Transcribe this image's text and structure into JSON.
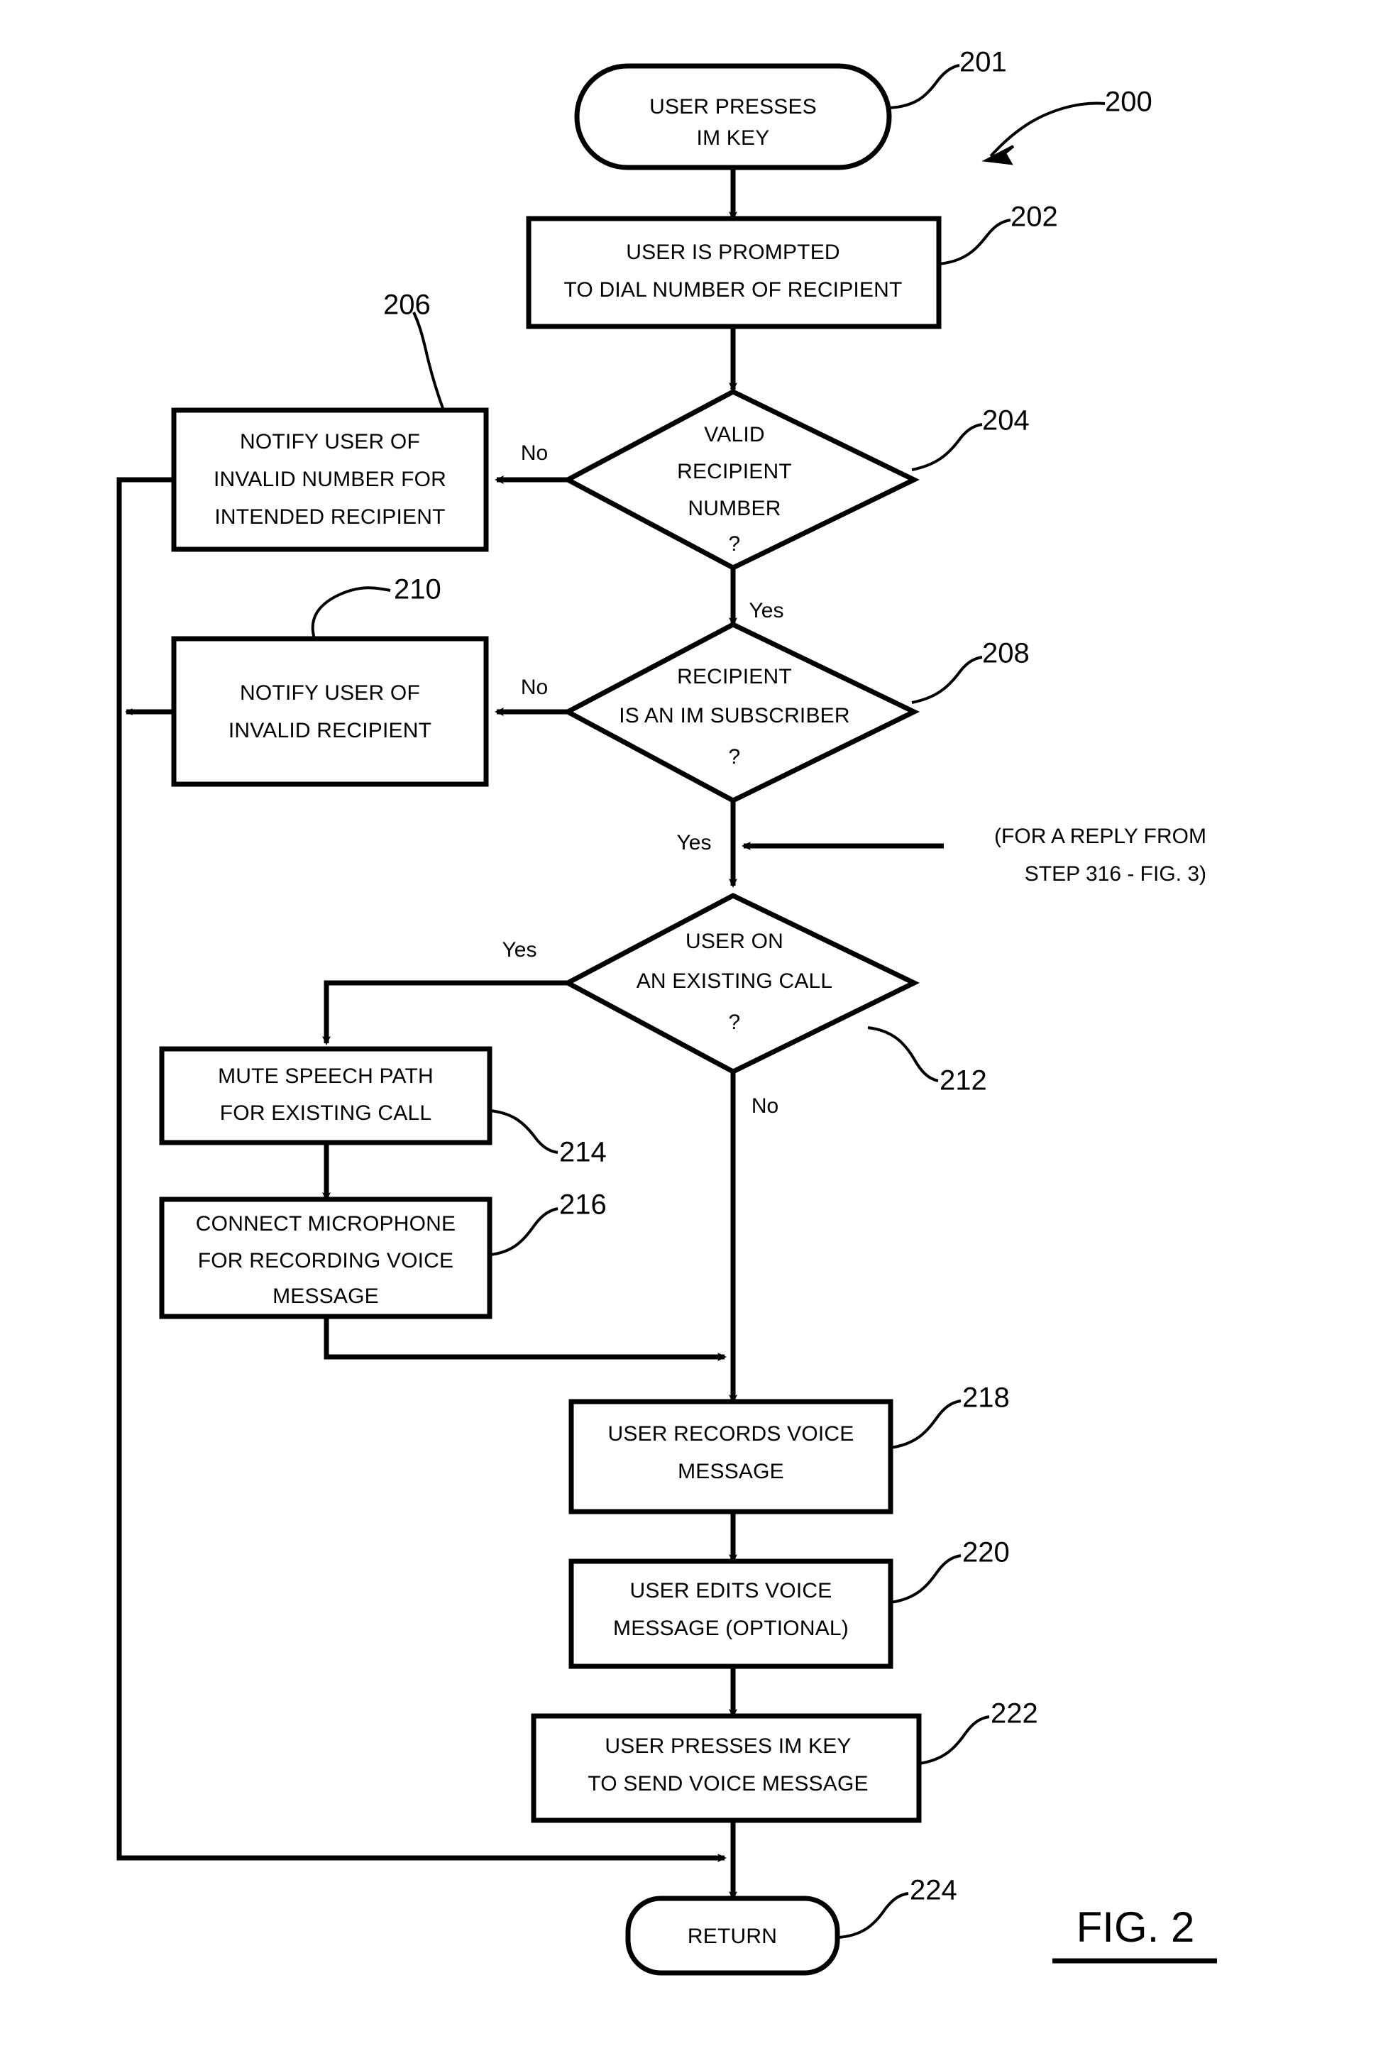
{
  "figure": {
    "label": "FIG. 2",
    "overall_ref": "200"
  },
  "nodes": {
    "start": {
      "ref": "201",
      "shape": "terminator",
      "lines": [
        "USER PRESSES",
        "IM KEY"
      ]
    },
    "prompt": {
      "ref": "202",
      "shape": "process",
      "lines": [
        "USER IS PROMPTED",
        "TO DIAL NUMBER OF RECIPIENT"
      ]
    },
    "valid_number": {
      "ref": "204",
      "shape": "decision",
      "lines": [
        "VALID",
        "RECIPIENT",
        "NUMBER",
        "?"
      ]
    },
    "notify_invalid_number": {
      "ref": "206",
      "shape": "process",
      "lines": [
        "NOTIFY USER OF",
        "INVALID NUMBER FOR",
        "INTENDED RECIPIENT"
      ]
    },
    "im_subscriber": {
      "ref": "208",
      "shape": "decision",
      "lines": [
        "RECIPIENT",
        "IS AN IM SUBSCRIBER",
        "?"
      ]
    },
    "notify_invalid_recipient": {
      "ref": "210",
      "shape": "process",
      "lines": [
        "NOTIFY USER OF",
        "INVALID RECIPIENT"
      ]
    },
    "existing_call": {
      "ref": "212",
      "shape": "decision",
      "lines": [
        "USER ON",
        "AN EXISTING CALL",
        "?"
      ]
    },
    "mute_speech": {
      "ref": "214",
      "shape": "process",
      "lines": [
        "MUTE SPEECH PATH",
        "FOR EXISTING CALL"
      ]
    },
    "connect_mic": {
      "ref": "216",
      "shape": "process",
      "lines": [
        "CONNECT MICROPHONE",
        "FOR RECORDING VOICE",
        "MESSAGE"
      ]
    },
    "records_message": {
      "ref": "218",
      "shape": "process",
      "lines": [
        "USER RECORDS VOICE",
        "MESSAGE"
      ]
    },
    "edits_message": {
      "ref": "220",
      "shape": "process",
      "lines": [
        "USER EDITS VOICE",
        "MESSAGE (OPTIONAL)"
      ]
    },
    "send_message": {
      "ref": "222",
      "shape": "process",
      "lines": [
        "USER PRESSES IM KEY",
        "TO SEND VOICE MESSAGE"
      ]
    },
    "return": {
      "ref": "224",
      "shape": "terminator",
      "lines": [
        "RETURN"
      ]
    }
  },
  "branch_labels": {
    "valid_number_no": "No",
    "valid_number_yes": "Yes",
    "im_subscriber_no": "No",
    "im_subscriber_yes": "Yes",
    "existing_call_yes": "Yes",
    "existing_call_no": "No"
  },
  "annotation": {
    "line1": "(FOR A REPLY FROM",
    "line2": "STEP 316 - FIG. 3)"
  },
  "colors": {
    "ink": "#000000",
    "paper": "#ffffff"
  }
}
